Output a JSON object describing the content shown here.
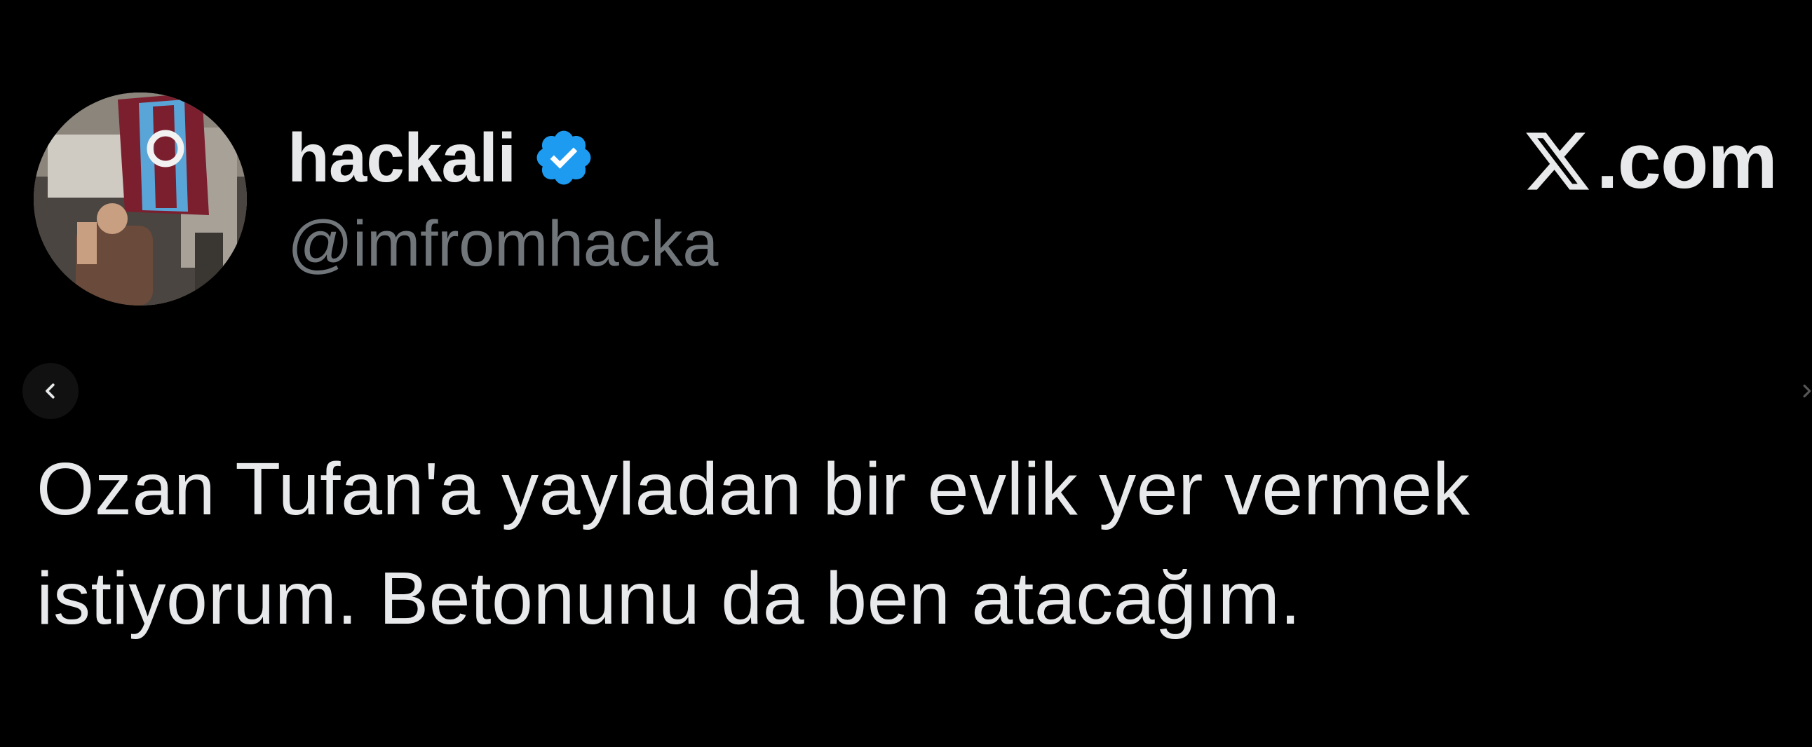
{
  "author": {
    "display_name": "hackali",
    "username": "@imfromhacka",
    "verified": true,
    "verified_badge_color": "#1d9bf0",
    "avatar_icon": "profile-photo"
  },
  "brand": {
    "text": ".com",
    "icon": "x-logo"
  },
  "navigation": {
    "prev_icon": "chevron-left",
    "next_icon": "chevron-right"
  },
  "tweet": {
    "lines": [
      "Ozan Tufan'a yayladan bir evlik yer vermek",
      "istiyorum. Betonunu da ben atacağım."
    ]
  },
  "colors": {
    "background": "#000000",
    "primary_text": "#e7e9ea",
    "secondary_text": "#71767b"
  }
}
